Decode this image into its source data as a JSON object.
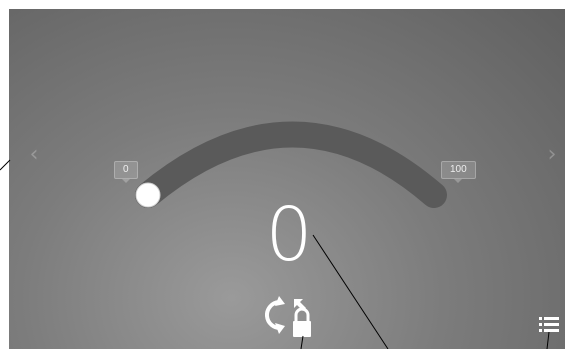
{
  "slider": {
    "min_label": "0",
    "max_label": "100",
    "current_value": "0",
    "value_fraction": 0.0
  },
  "icons": {
    "prev": "chevron-left-icon",
    "next": "chevron-right-icon",
    "rotate": "rotate-icon",
    "lock": "lock-icon",
    "menu": "list-menu-icon"
  },
  "colors": {
    "track": "#5a5a5a",
    "thumb": "#ffffff",
    "value_text": "#ffffff"
  }
}
